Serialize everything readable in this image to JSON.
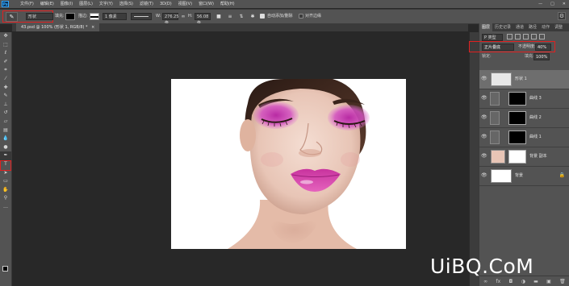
{
  "app": {
    "logo": "Ps"
  },
  "menu": [
    "文件(F)",
    "编辑(E)",
    "图像(I)",
    "图层(L)",
    "文字(Y)",
    "选择(S)",
    "滤镜(T)",
    "3D(D)",
    "视图(V)",
    "窗口(W)",
    "帮助(H)"
  ],
  "window_controls": [
    "—",
    "□",
    "✕"
  ],
  "options": {
    "mode": "形状",
    "fill_label": "填充:",
    "stroke_label": "描边:",
    "stroke_width": "1 像素",
    "w_label": "W:",
    "w_value": "276.25 像",
    "h_label": "H:",
    "h_value": "56.08 像",
    "auto_add_delete": "自动添加/删除",
    "align_edges": "对齐边缘"
  },
  "document": {
    "tab_title": "43.psd @ 100% (形状 1, RGB/8) *",
    "tab_close": "×"
  },
  "layers_panel": {
    "tabs": [
      "图层",
      "历史记录",
      "通道",
      "路径",
      "动作",
      "调整"
    ],
    "filter_kind": "P 类型",
    "blend_mode": "正片叠底",
    "opacity_label": "不透明度:",
    "opacity": "40%",
    "lock_label": "锁定:",
    "fill_label": "填充:",
    "fill": "100%",
    "layers": [
      {
        "name": "形状 1",
        "type": "shape",
        "visible": true,
        "selected": true
      },
      {
        "name": "曲线 3",
        "type": "adjustment",
        "visible": true,
        "selected": false
      },
      {
        "name": "曲线 2",
        "type": "adjustment",
        "visible": true,
        "selected": false
      },
      {
        "name": "曲线 1",
        "type": "adjustment",
        "visible": true,
        "selected": false
      },
      {
        "name": "背景 副本",
        "type": "pixel",
        "visible": true,
        "selected": false
      },
      {
        "name": "背景",
        "type": "background",
        "visible": true,
        "selected": false
      }
    ],
    "footer_icons": [
      "link-icon",
      "fx-icon",
      "mask-icon",
      "adjustment-icon",
      "folder-icon",
      "new-layer-icon",
      "trash-icon"
    ]
  },
  "tools": [
    "move-tool-icon",
    "marquee-tool-icon",
    "lasso-tool-icon",
    "quick-select-icon",
    "crop-tool-icon",
    "eyedropper-icon",
    "healing-brush-icon",
    "brush-tool-icon",
    "clone-stamp-icon",
    "history-brush-icon",
    "eraser-icon",
    "gradient-icon",
    "blur-icon",
    "dodge-icon",
    "pen-tool-icon",
    "type-tool-icon",
    "path-select-icon",
    "shape-tool-icon",
    "hand-tool-icon",
    "zoom-tool-icon",
    "more-tools-icon"
  ],
  "watermark": "UiBQ.CoM",
  "colors": {
    "highlight_box": "#e02020",
    "app_bg": "#282828",
    "panel_bg": "#535353",
    "makeup": "#d03fb0"
  }
}
